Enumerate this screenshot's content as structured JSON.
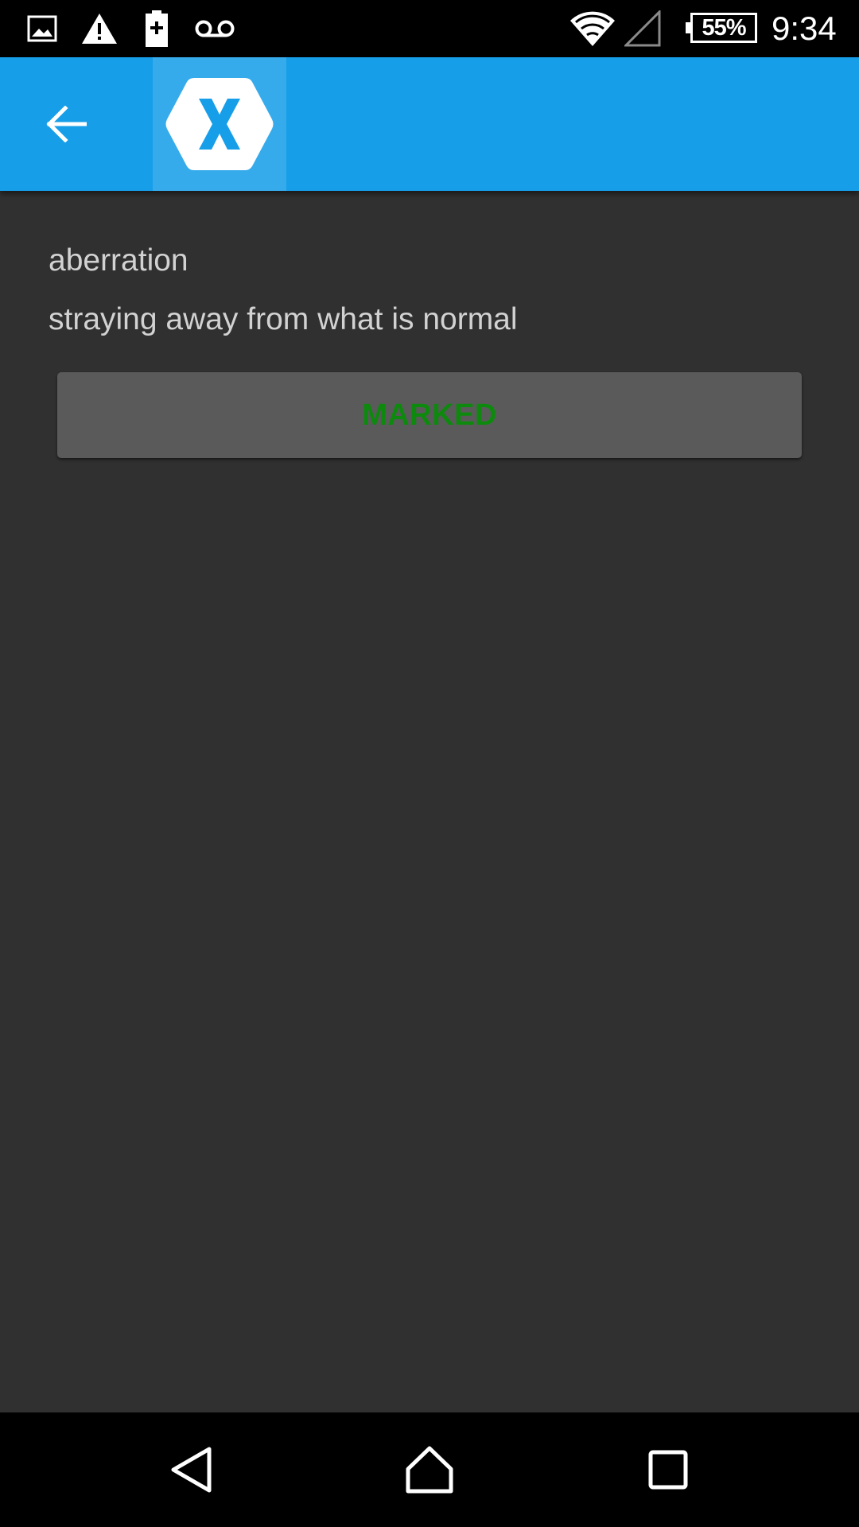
{
  "status_bar": {
    "icons": [
      "image-icon",
      "warning-icon",
      "battery-saver-icon",
      "voicemail-icon",
      "wifi-icon",
      "cell-signal-icon"
    ],
    "battery_level": "55%",
    "time": "9:34"
  },
  "app_bar": {
    "back_icon": "arrow-left-icon",
    "app_icon": "xamarin-logo-icon",
    "background_color": "#169ee9"
  },
  "entry": {
    "word": "aberration",
    "definition": "straying away from what is normal"
  },
  "marked_button": {
    "label": "MARKED",
    "label_color": "#0d8a0d"
  },
  "nav_bar": {
    "icons": [
      "back-triangle-icon",
      "home-icon",
      "recents-icon"
    ]
  }
}
